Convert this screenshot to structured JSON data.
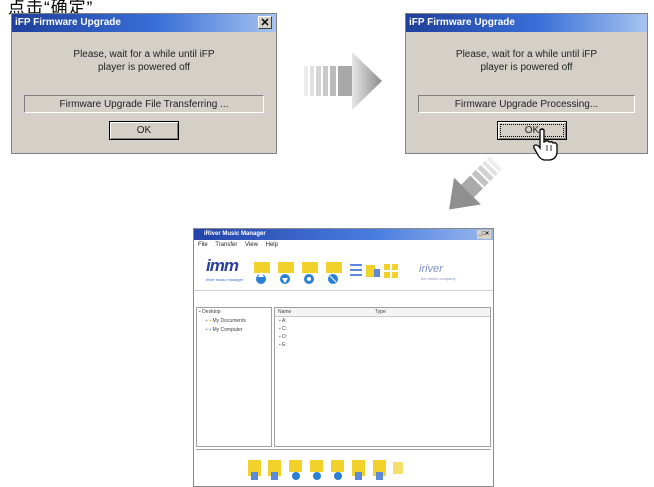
{
  "caption": "点击“确定”",
  "dialog_left": {
    "title": "iFP Firmware Upgrade",
    "message_line1": "Please, wait for a while until iFP",
    "message_line2": "player is powered off",
    "status": "Firmware Upgrade File Transferring ...",
    "ok_label": "OK",
    "close_label": "✕"
  },
  "dialog_right": {
    "title": "iFP Firmware Upgrade",
    "message_line1": "Please, wait for a while until iFP",
    "message_line2": "player is powered off",
    "status": "Firmware Upgrade Processing...",
    "ok_label": "OK"
  },
  "app": {
    "title": "iRiver Music Manager",
    "window_controls": "_□×",
    "menu": [
      "File",
      "Transfer",
      "View",
      "Help"
    ],
    "logo": "imm",
    "logo_sub": "iriver music manager",
    "brand": "iriver",
    "brand_sub": "the music company",
    "tree": [
      "Desktop",
      "My Documents",
      "My Computer"
    ],
    "list_headers": [
      "Name",
      "Type"
    ],
    "list_rows": [
      "A:",
      "C:",
      "D:",
      "E:"
    ]
  },
  "colors": {
    "dialog_bg": "#d4d0c8",
    "titlebar": "#1f3f9a",
    "arrow": "#9a9a9a",
    "toolbar_icon": "#f2d12a",
    "toolbar_icon_accent": "#2a7fd6"
  }
}
